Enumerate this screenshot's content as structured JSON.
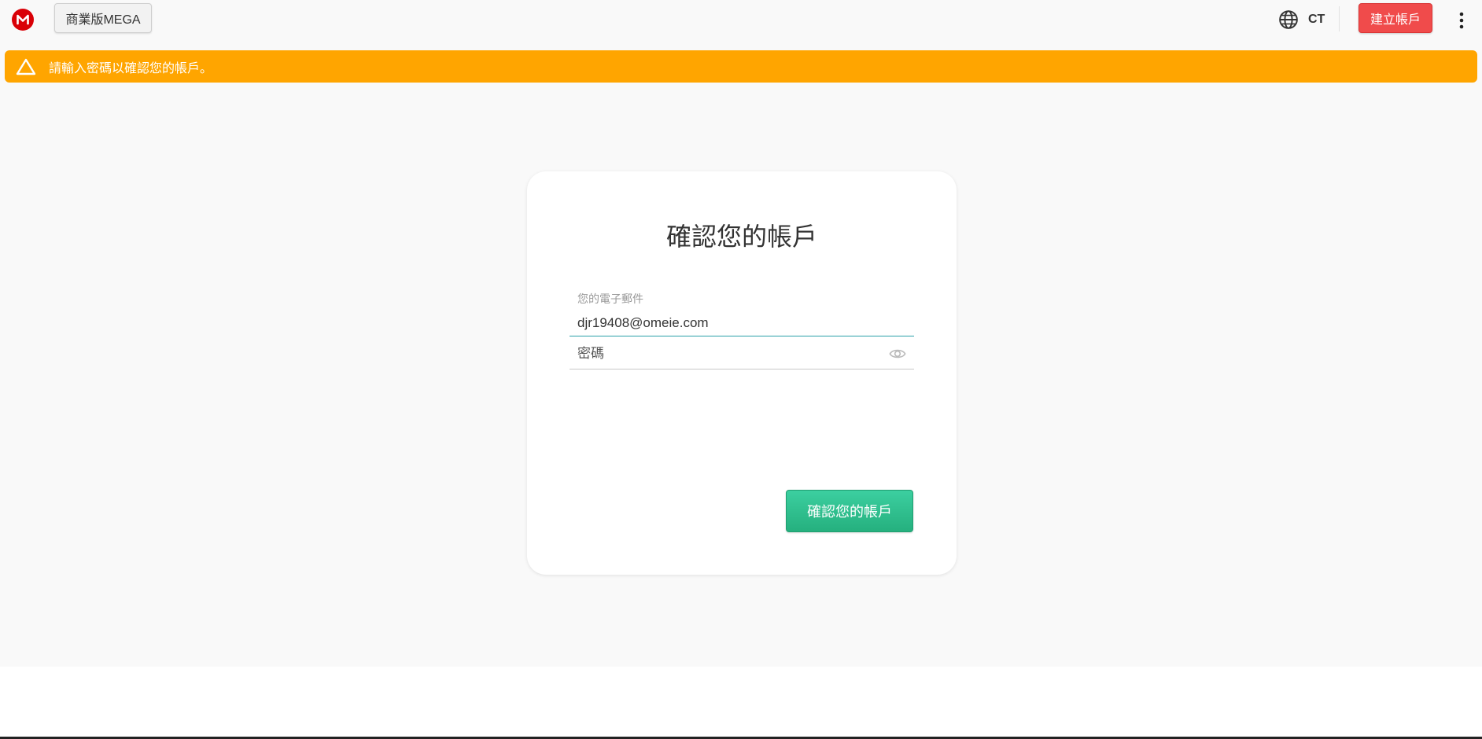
{
  "header": {
    "logo_icon": "mega-logo-icon",
    "brand_color": "#d90007",
    "business_label": "商業版MEGA",
    "language_icon": "globe-icon",
    "language_label": "CT",
    "create_account_label": "建立帳戶",
    "menu_icon": "more-vertical-icon"
  },
  "alert": {
    "icon": "warning-triangle-icon",
    "message": "請輸入密碼以確認您的帳戶。",
    "color": "#ffa500"
  },
  "card": {
    "title": "確認您的帳戶",
    "email": {
      "label": "您的電子郵件",
      "value": "djr19408@omeie.com"
    },
    "password": {
      "placeholder": "密碼",
      "value": "",
      "toggle_icon": "eye-icon"
    },
    "confirm_label": "確認您的帳戶",
    "confirm_color": "#2bbf8c"
  }
}
